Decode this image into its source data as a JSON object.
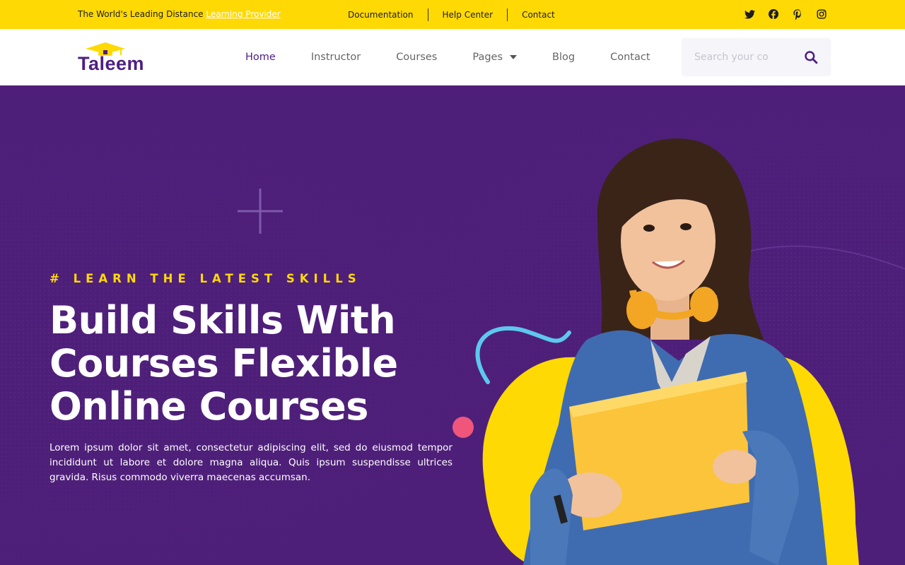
{
  "topbar": {
    "tagline": "The World's Leading Distance",
    "tagline_link": "Learning Provider",
    "links": [
      "Documentation",
      "Help Center",
      "Contact"
    ],
    "socials": [
      "twitter-icon",
      "facebook-icon",
      "pinterest-icon",
      "instagram-icon"
    ]
  },
  "header": {
    "logo_text": "Taleem",
    "nav": [
      {
        "label": "Home",
        "active": true
      },
      {
        "label": "Instructor"
      },
      {
        "label": "Courses"
      },
      {
        "label": "Pages",
        "dropdown": true
      },
      {
        "label": "Blog"
      },
      {
        "label": "Contact"
      }
    ],
    "search_placeholder": "Search your co"
  },
  "hero": {
    "subtitle": "# LEARN THE LATEST SKILLS",
    "headline_lines": [
      "Build Skills With",
      "Courses Flexible",
      "Online Courses"
    ],
    "description": "Lorem ipsum dolor sit amet, consectetur adipiscing elit, sed do eiusmod tempor incididunt ut labore et dolore magna aliqua. Quis ipsum suspendisse ultrices gravida. Risus commodo viverra maecenas accumsan."
  },
  "colors": {
    "accent_yellow": "#FFD904",
    "brand_purple": "#4E1F82",
    "hero_bg": "#4E1F79"
  }
}
